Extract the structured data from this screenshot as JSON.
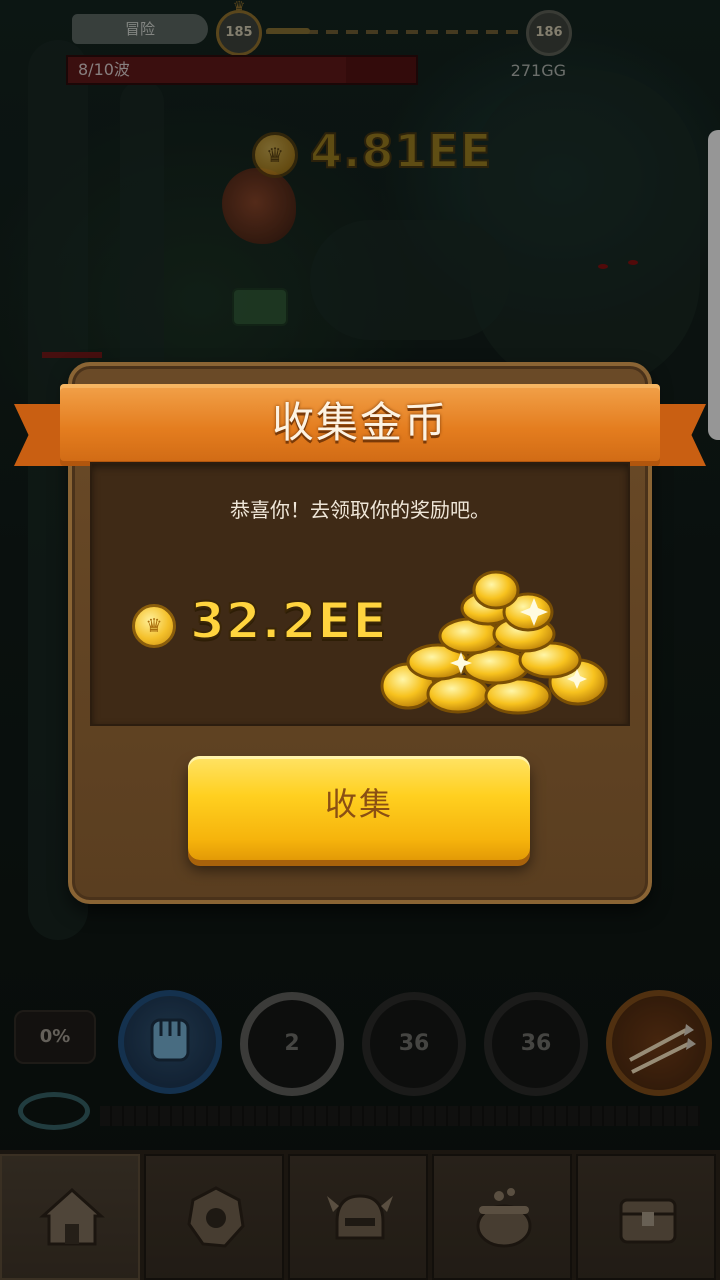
{
  "hud": {
    "mode_label": "冒险",
    "current_stage": "185",
    "next_stage": "186",
    "wave_text": "8/10波",
    "wave_progress": 0.8,
    "gg_amount": "271GG",
    "gold_amount": "4.81EE"
  },
  "dialog": {
    "title": "收集金币",
    "message": "恭喜你！去领取你的奖励吧。",
    "reward_amount": "32.2EE",
    "collect_button": "收集"
  },
  "skills": {
    "percent_label": "0%",
    "slot_fist_icon": "fist-icon",
    "cooldown_1": "2",
    "cooldown_2": "36",
    "cooldown_3": "36",
    "slot_arrows_icon": "arrows-icon"
  },
  "nav": {
    "items": [
      {
        "icon": "home-icon",
        "active": true
      },
      {
        "icon": "gear-icon",
        "active": false
      },
      {
        "icon": "helmet-icon",
        "active": false
      },
      {
        "icon": "cauldron-icon",
        "active": false
      },
      {
        "icon": "chest-icon",
        "active": false
      }
    ]
  },
  "colors": {
    "ribbon": "#e47d1f",
    "button": "#ffd020",
    "gold_text": "#ffd43e"
  }
}
